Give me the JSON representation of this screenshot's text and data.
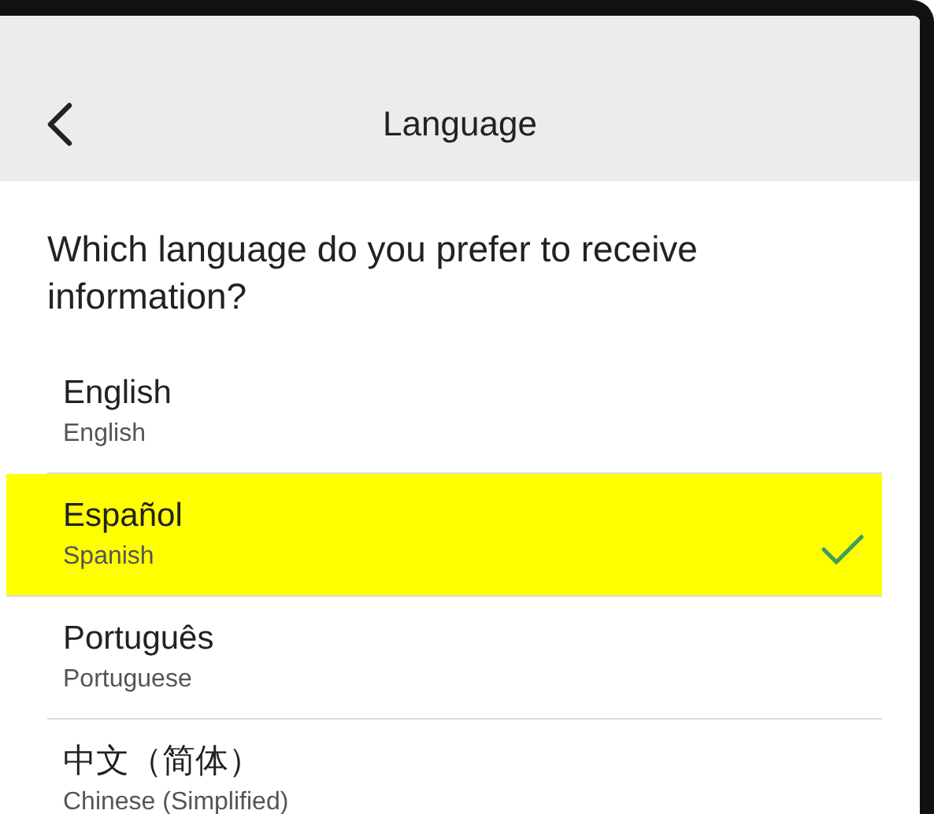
{
  "header": {
    "title": "Language"
  },
  "question": "Which language do you prefer to receive information?",
  "languages": [
    {
      "name": "English",
      "subtitle": "English",
      "selected": false,
      "highlighted": false
    },
    {
      "name": "Español",
      "subtitle": "Spanish",
      "selected": true,
      "highlighted": true
    },
    {
      "name": "Português",
      "subtitle": "Portuguese",
      "selected": false,
      "highlighted": false
    },
    {
      "name": "中文（简体）",
      "subtitle": "Chinese (Simplified)",
      "selected": false,
      "highlighted": false
    }
  ]
}
